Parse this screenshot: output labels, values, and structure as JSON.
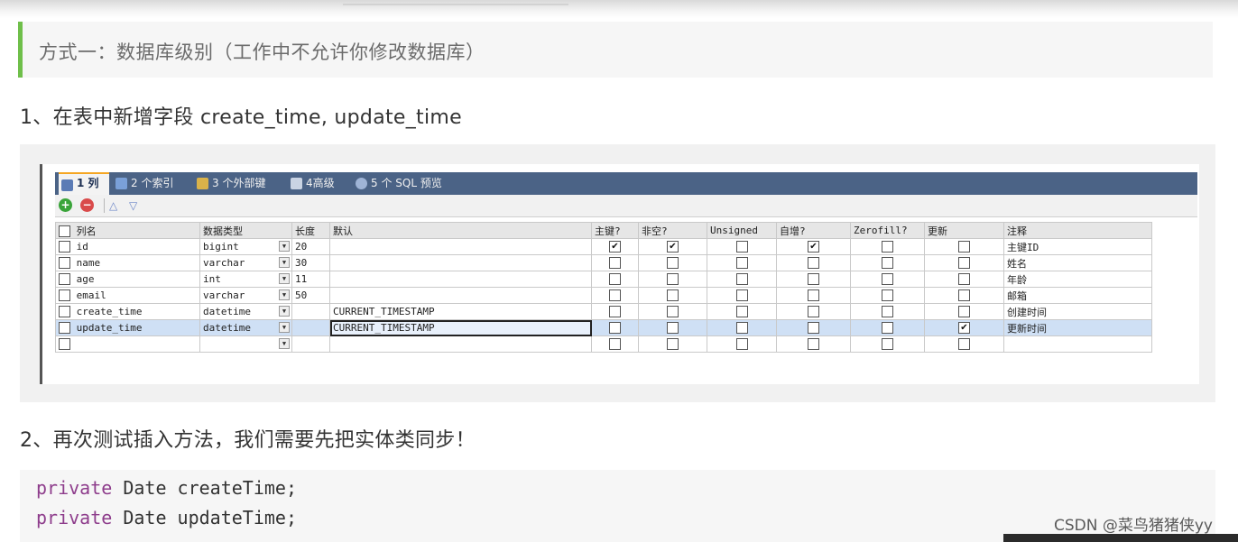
{
  "quote_text": "方式一：数据库级别（工作中不允许你修改数据库）",
  "step1": "1、在表中新增字段 create_time, update_time",
  "step2": "2、再次测试插入方法，我们需要先把实体类同步！",
  "tabs": [
    {
      "label": "1 列",
      "icon": "columns-icon",
      "active": true
    },
    {
      "label": "2 个索引",
      "icon": "index-icon"
    },
    {
      "label": "3 个外部键",
      "icon": "foreign-key-icon"
    },
    {
      "label": "4高级",
      "icon": "advanced-icon"
    },
    {
      "label": "5 个 SQL 预览",
      "icon": "sql-preview-icon"
    }
  ],
  "toolbar": {
    "add_icon": "+",
    "remove_icon": "−",
    "up_icon": "△",
    "down_icon": "▽"
  },
  "headers": [
    "列名",
    "数据类型",
    "长度",
    "默认",
    "主键?",
    "非空?",
    "Unsigned",
    "自增?",
    "Zerofill?",
    "更新",
    "注释"
  ],
  "rows": [
    {
      "name": "id",
      "type": "bigint",
      "length": "20",
      "default": "",
      "pk": true,
      "notnull": true,
      "unsigned": false,
      "autoinc": true,
      "zerofill": false,
      "update": false,
      "comment": "主键ID"
    },
    {
      "name": "name",
      "type": "varchar",
      "length": "30",
      "default": "",
      "pk": false,
      "notnull": false,
      "unsigned": false,
      "autoinc": false,
      "zerofill": false,
      "update": false,
      "comment": "姓名"
    },
    {
      "name": "age",
      "type": "int",
      "length": "11",
      "default": "",
      "pk": false,
      "notnull": false,
      "unsigned": false,
      "autoinc": false,
      "zerofill": false,
      "update": false,
      "comment": "年龄"
    },
    {
      "name": "email",
      "type": "varchar",
      "length": "50",
      "default": "",
      "pk": false,
      "notnull": false,
      "unsigned": false,
      "autoinc": false,
      "zerofill": false,
      "update": false,
      "comment": "邮箱"
    },
    {
      "name": "create_time",
      "type": "datetime",
      "length": "",
      "default": "CURRENT_TIMESTAMP",
      "pk": false,
      "notnull": false,
      "unsigned": false,
      "autoinc": false,
      "zerofill": false,
      "update": false,
      "comment": "创建时间"
    },
    {
      "name": "update_time",
      "type": "datetime",
      "length": "",
      "default": "CURRENT_TIMESTAMP",
      "pk": false,
      "notnull": false,
      "unsigned": false,
      "autoinc": false,
      "zerofill": false,
      "update": true,
      "comment": "更新时间",
      "selected": true
    },
    {
      "name": "",
      "type": "",
      "length": "",
      "default": "",
      "pk": false,
      "notnull": false,
      "unsigned": false,
      "autoinc": false,
      "zerofill": false,
      "update": false,
      "comment": ""
    }
  ],
  "code": [
    {
      "keyword": "private",
      "rest": " Date createTime;"
    },
    {
      "keyword": "private",
      "rest": " Date updateTime;"
    }
  ],
  "watermark": "CSDN @菜鸟猪猪侠yy",
  "colors": {
    "accent_bar": "#6fbf4a",
    "tabbar": "#4b6386",
    "keyword": "#8e3d8c",
    "selected_row": "#cfe0f5"
  }
}
